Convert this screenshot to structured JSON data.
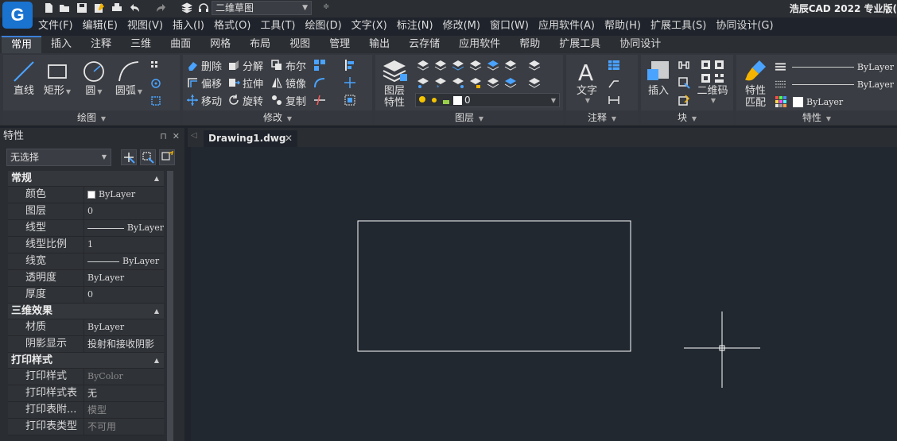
{
  "app": {
    "logo_letter": "G",
    "title": "浩辰CAD 2022 专业版(",
    "workspace": "二维草图"
  },
  "menu": [
    "文件(F)",
    "编辑(E)",
    "视图(V)",
    "插入(I)",
    "格式(O)",
    "工具(T)",
    "绘图(D)",
    "文字(X)",
    "标注(N)",
    "修改(M)",
    "窗口(W)",
    "应用软件(A)",
    "帮助(H)",
    "扩展工具(S)",
    "协同设计(G)"
  ],
  "ribbon_tabs": [
    "常用",
    "插入",
    "注释",
    "三维",
    "曲面",
    "网格",
    "布局",
    "视图",
    "管理",
    "输出",
    "云存储",
    "应用软件",
    "帮助",
    "扩展工具",
    "协同设计"
  ],
  "active_tab": "常用",
  "ribbon": {
    "draw": {
      "label": "绘图",
      "line": "直线",
      "rect": "矩形",
      "circle": "圆",
      "arc": "圆弧"
    },
    "modify": {
      "label": "修改",
      "erase": "删除",
      "explode": "分解",
      "boolean": "布尔",
      "offset": "偏移",
      "stretch": "拉伸",
      "mirror": "镜像",
      "move": "移动",
      "rotate": "旋转",
      "copy": "复制"
    },
    "layer": {
      "label": "图层",
      "props_line1": "图层",
      "props_line2": "特性",
      "current": "0"
    },
    "annot": {
      "label": "注释",
      "text": "文字"
    },
    "block": {
      "label": "块",
      "insert": "插入",
      "qr": "二维码"
    },
    "props": {
      "label": "特性",
      "match_line1": "特性",
      "match_line2": "匹配",
      "bylayer1": "ByLayer",
      "bylayer2": "ByLayer",
      "bylayer3": "ByLayer"
    }
  },
  "palette": {
    "title": "特性",
    "selection": "无选择",
    "sections": {
      "general": "常规",
      "effects3d": "三维效果",
      "plotstyle": "打印样式"
    },
    "general": [
      {
        "k": "颜色",
        "v": "ByLayer"
      },
      {
        "k": "图层",
        "v": "0"
      },
      {
        "k": "线型",
        "v": "ByLayer"
      },
      {
        "k": "线型比例",
        "v": "1"
      },
      {
        "k": "线宽",
        "v": "ByLayer"
      },
      {
        "k": "透明度",
        "v": "ByLayer"
      },
      {
        "k": "厚度",
        "v": "0"
      }
    ],
    "effects3d": [
      {
        "k": "材质",
        "v": "ByLayer"
      },
      {
        "k": "阴影显示",
        "v": "投射和接收阴影"
      }
    ],
    "plotstyle": [
      {
        "k": "打印样式",
        "v": "ByColor"
      },
      {
        "k": "打印样式表",
        "v": "无"
      },
      {
        "k": "打印表附...",
        "v": "模型"
      },
      {
        "k": "打印表类型",
        "v": "不可用"
      }
    ]
  },
  "document": {
    "tab": "Drawing1.dwg"
  },
  "colors": {
    "canvas": "#212830",
    "accent": "#3b7fd8",
    "logo": "#1b73d0"
  }
}
